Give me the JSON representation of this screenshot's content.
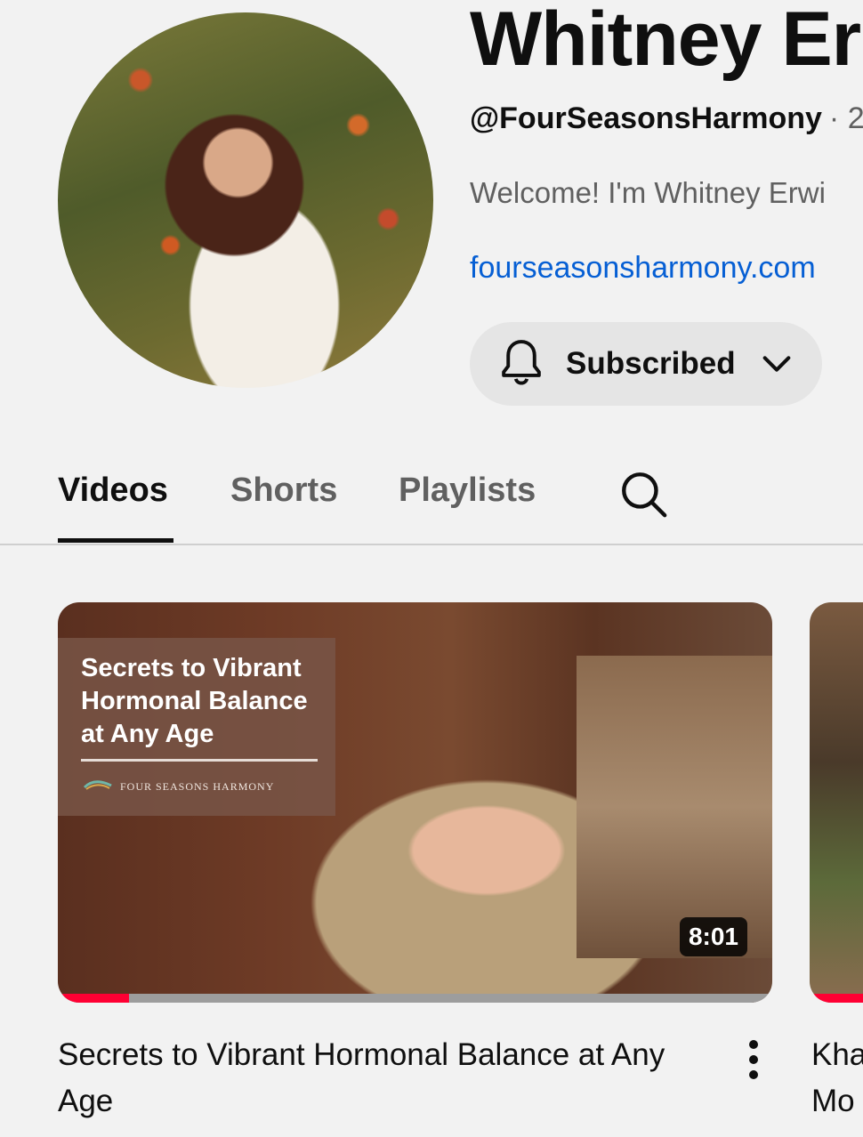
{
  "channel": {
    "name": "Whitney Er",
    "handle": "@FourSeasonsHarmony",
    "handle_sep": "· 2",
    "description": "Welcome! I'm Whitney Erwi",
    "link": "fourseasonsharmony.com"
  },
  "subscribe": {
    "label": "Subscribed",
    "icon": "bell-icon",
    "dropdown_icon": "chevron-down-icon"
  },
  "tabs": [
    {
      "label": "Videos",
      "active": true
    },
    {
      "label": "Shorts",
      "active": false
    },
    {
      "label": "Playlists",
      "active": false
    }
  ],
  "tab_search_icon": "search-icon",
  "videos": [
    {
      "title": "Secrets to Vibrant Hormonal Balance at Any Age",
      "thumbnail_overlay": "Secrets to Vibrant Hormonal Balance at Any Age",
      "thumbnail_brand": "FOUR SEASONS HARMONY",
      "duration": "8:01",
      "watched_fraction": 0.1
    },
    {
      "title_line1": "Kha",
      "title_line2": "Mo"
    }
  ],
  "colors": {
    "accent_link": "#065fd4",
    "progress": "#ff0033",
    "background": "#f2f2f2"
  }
}
